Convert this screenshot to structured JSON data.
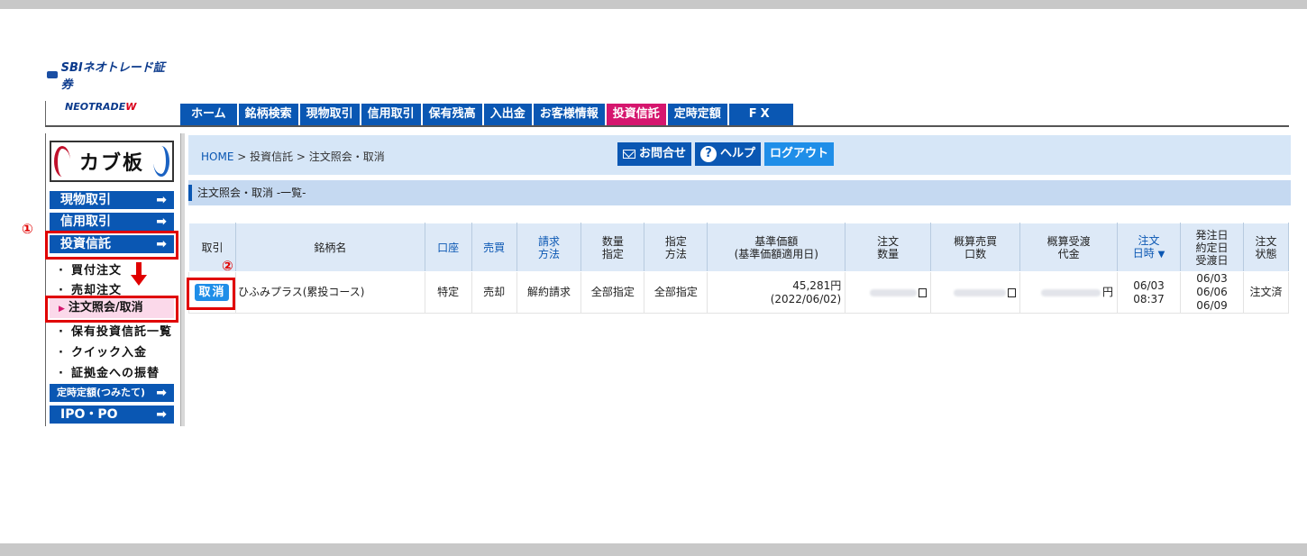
{
  "logo": {
    "brand": "SBIネオトレード証券",
    "sub": "NEOTRADE",
    "sub_w": "W"
  },
  "topnav": [
    {
      "label": "ホーム",
      "active": false
    },
    {
      "label": "銘柄検索",
      "active": false
    },
    {
      "label": "現物取引",
      "active": false
    },
    {
      "label": "信用取引",
      "active": false
    },
    {
      "label": "保有残高",
      "active": false
    },
    {
      "label": "入出金",
      "active": false
    },
    {
      "label": "お客様情報",
      "active": false
    },
    {
      "label": "投資信託",
      "active": true
    },
    {
      "label": "定時定額",
      "active": false
    },
    {
      "label": "FX",
      "active": false
    }
  ],
  "sidebar": {
    "kabu_logo": "カブ板",
    "btn_genbutsu": "現物取引",
    "btn_shinyo": "信用取引",
    "btn_toshin": "投資信託",
    "link_kaitsuke": "買付注文",
    "link_baikyaku": "売却注文",
    "active_item": "注文照会/取消",
    "link_hoyu": "保有投資信託一覧",
    "link_quick": "クイック入金",
    "link_shokokin": "証拠金への振替",
    "btn_teiji": "定時定額(つみたて)",
    "btn_ipo": "IPO・PO",
    "arrow": "➡"
  },
  "annotations": {
    "one": "①",
    "two": "②"
  },
  "breadcrumb": {
    "home": "HOME",
    "sep1": " > ",
    "mid": "投資信託",
    "sep2": " > ",
    "current": "注文照会・取消"
  },
  "header_buttons": {
    "contact": "お問合せ",
    "help": "ヘルプ",
    "logout": "ログアウト"
  },
  "section_title": "注文照会・取消 -一覧-",
  "table": {
    "headers": {
      "torihiki": "取引",
      "meigara": "銘柄名",
      "koza": "口座",
      "baibai": "売買",
      "seikyu": [
        "請求",
        "方法"
      ],
      "suryo": [
        "数量",
        "指定"
      ],
      "shitei": [
        "指定",
        "方法"
      ],
      "kijun": [
        "基準価額",
        "(基準価額適用日)"
      ],
      "chumon_suryo": [
        "注文",
        "数量"
      ],
      "gaisan_baibai": [
        "概算売買",
        "口数"
      ],
      "gaisan_ukewatashi": [
        "概算受渡",
        "代金"
      ],
      "chumon_nichiji": [
        "注文",
        "日時"
      ],
      "dates": [
        "発注日",
        "約定日",
        "受渡日"
      ],
      "jotai": [
        "注文",
        "状態"
      ]
    },
    "row": {
      "cancel": "取消",
      "name": "ひふみプラス(累投コース)",
      "koza": "特定",
      "baibai": "売却",
      "seikyu": "解約請求",
      "suryo": "全部指定",
      "shitei": "全部指定",
      "price": "45,281円",
      "price_date": "(2022/06/02)",
      "unit_yen": "円",
      "order_date": "06/03",
      "order_time": "08:37",
      "hatchu": "06/03",
      "yakujo": "06/06",
      "ukewatashi": "06/09",
      "status": "注文済"
    },
    "sort_icon": "▼"
  },
  "colors": {
    "nav_blue": "#0a57b3",
    "nav_active": "#d5166e",
    "accent_blue": "#1f8ee8",
    "annotation_red": "#e00000"
  }
}
